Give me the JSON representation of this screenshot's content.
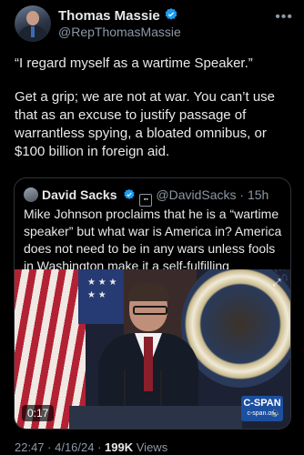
{
  "tweet": {
    "author_name": "Thomas Massie",
    "author_handle": "@RepThomasMassie",
    "paragraphs": [
      "“I regard myself as a wartime Speaker.”",
      "Get a grip; we are not at war. You can’t use that as an excuse to justify passage of warrantless spying, a bloated omnibus, or $100 billion in foreign aid."
    ],
    "time": "22:47",
    "date": "4/16/24",
    "views_count": "199K",
    "views_label": "Views",
    "verified_color": "#1d9bf0"
  },
  "quote": {
    "author_name": "David Sacks",
    "author_handle": "@DavidSacks",
    "age": "15h",
    "text": "Mike Johnson proclaims that he is a “wartime speaker” but what war is America in? America does not need to be in any wars unless fools in Washington make it a self-fulfilling prophecy.",
    "video": {
      "duration": "0:17",
      "network_logo": "C-SPAN",
      "network_url": "c-span.org",
      "seal_text": "RESENTATIVES"
    }
  },
  "icons": [
    "more-icon",
    "verified-icon",
    "affiliate-badge-icon",
    "volume-icon",
    "expand-icon"
  ]
}
